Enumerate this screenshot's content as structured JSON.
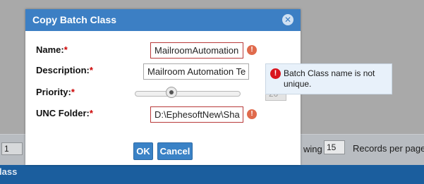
{
  "background": {
    "page_number": "1",
    "showing_label": "wing",
    "records_per_page_value": "15",
    "records_per_page_label": "Records per page",
    "header_text": "lass"
  },
  "dialog": {
    "title": "Copy Batch Class",
    "close_icon": "close-icon",
    "fields": {
      "name": {
        "label": "Name:",
        "required_mark": "*",
        "value": "MailroomAutomation"
      },
      "description": {
        "label": "Description:",
        "required_mark": "*",
        "value": "Mailroom Automation Te"
      },
      "priority": {
        "label": "Priority:",
        "required_mark": "*",
        "value": "20"
      },
      "unc_folder": {
        "label": "UNC Folder:",
        "required_mark": "*",
        "value": "D:\\EphesoftNew\\Sha"
      }
    },
    "buttons": {
      "ok_label": "OK",
      "cancel_label": "Cancel"
    },
    "error_icon_glyph": "!"
  },
  "tooltip": {
    "message": "Batch Class name is not unique.",
    "icon": "error-icon",
    "icon_glyph": "!"
  },
  "colors": {
    "titlebar": "#3c7fc4",
    "button": "#3a82c6",
    "required": "#cc0000",
    "error_border": "#b83a3a",
    "header": "#1b5e9e"
  }
}
